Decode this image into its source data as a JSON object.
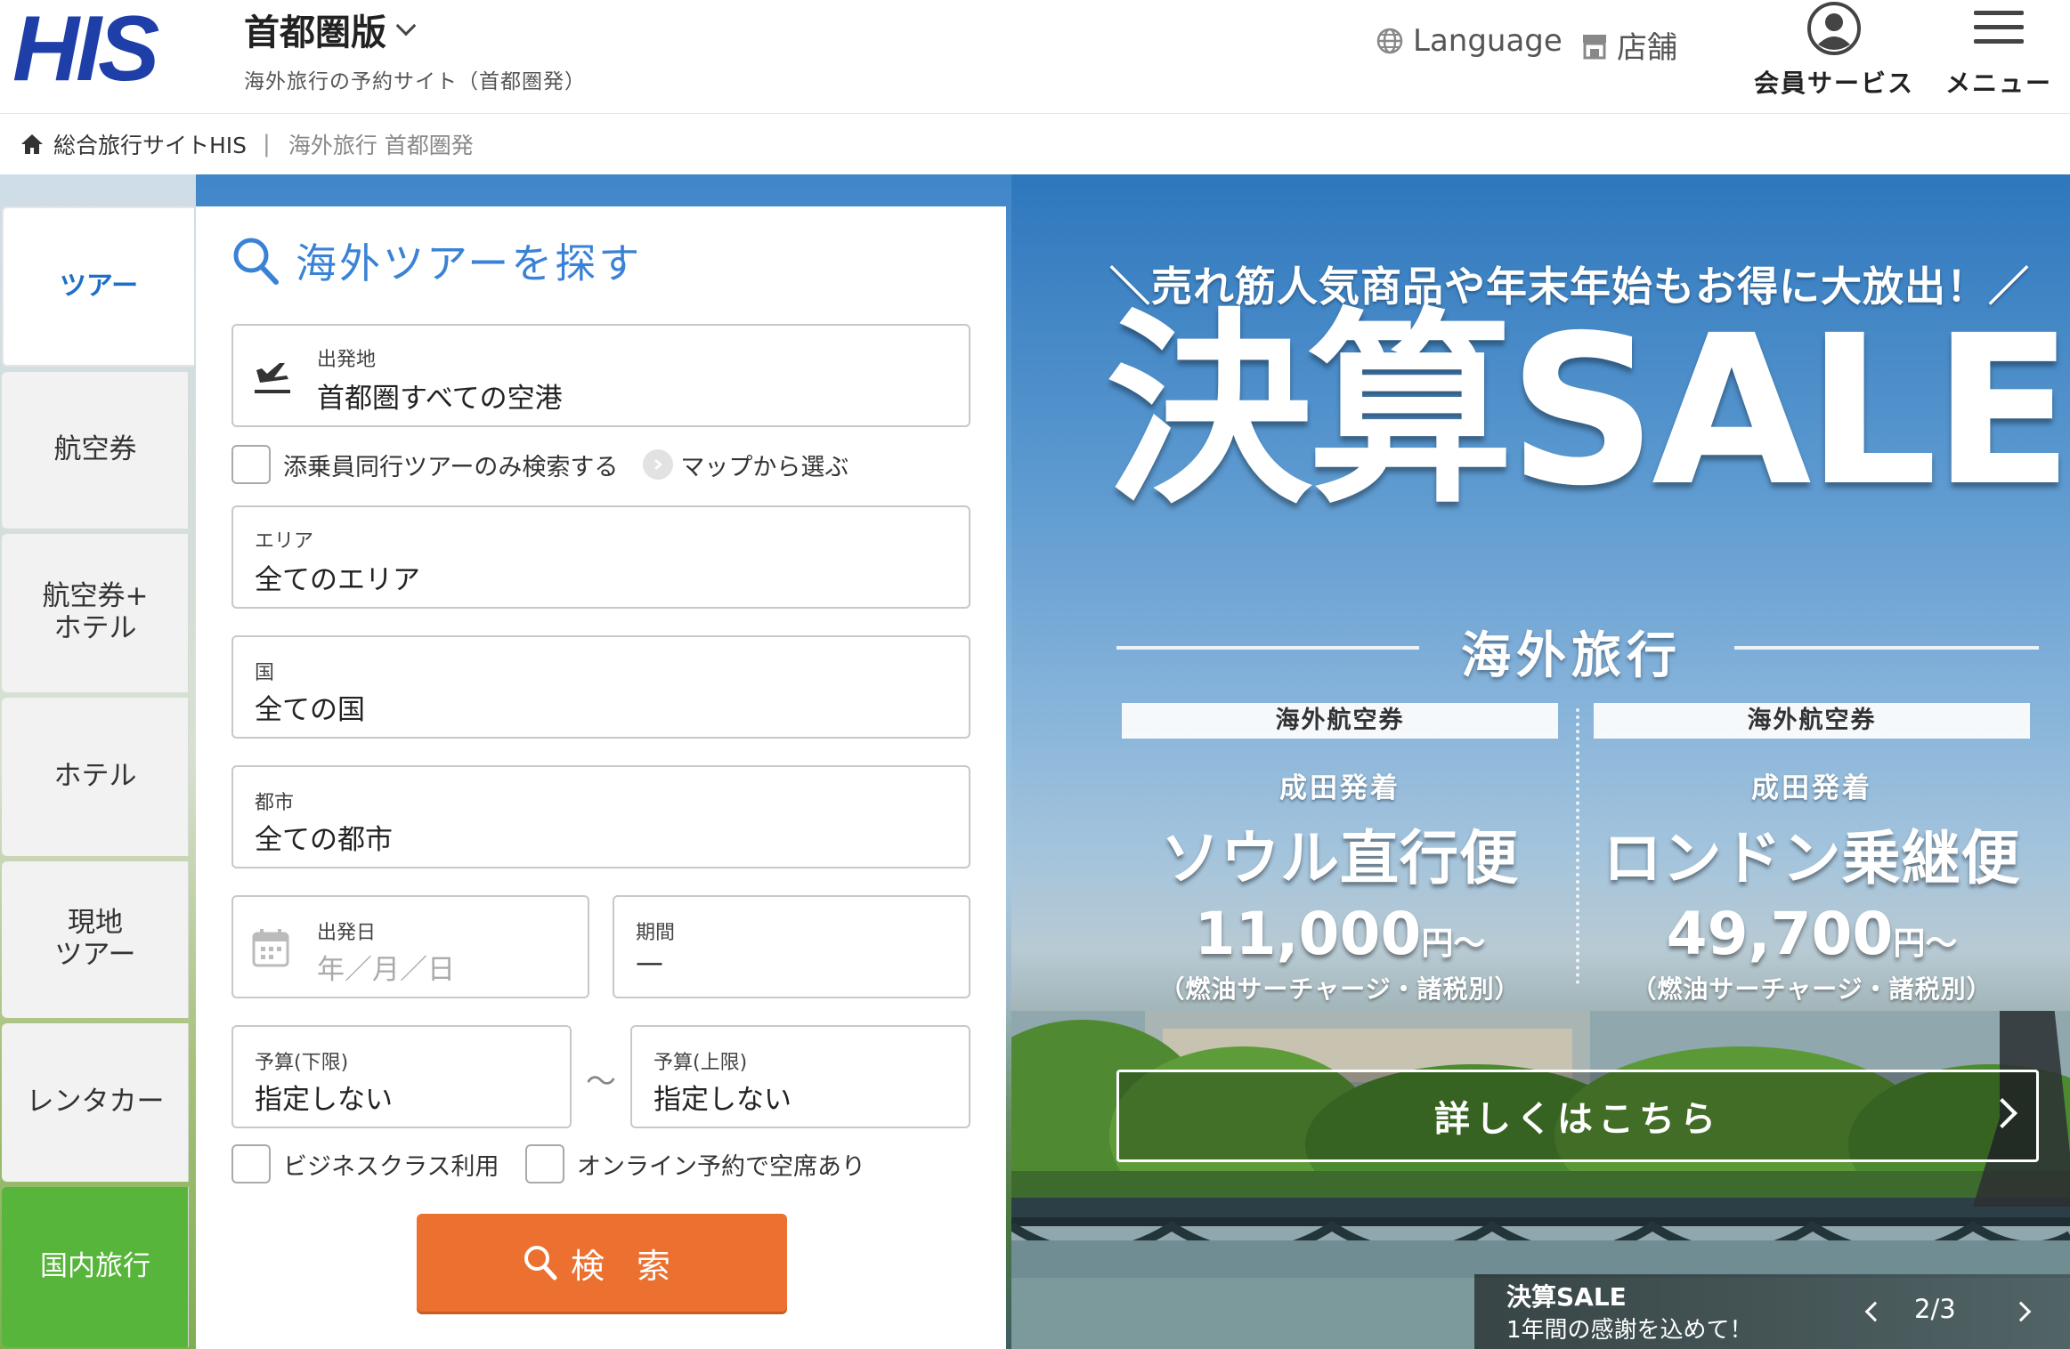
{
  "header": {
    "logo_text": "HIS",
    "site_title": "首都圏版",
    "site_subtitle": "海外旅行の予約サイト（首都圏発）",
    "language_label": "Language",
    "store_label": "店舗",
    "member_label": "会員サービス",
    "menu_label": "メニュー"
  },
  "breadcrumb": {
    "home_label": "総合旅行サイトHIS",
    "current_label": "海外旅行 首都圏発"
  },
  "tabs": {
    "tour": "ツアー",
    "air": "航空券",
    "air_hotel": "航空券+\nホテル",
    "hotel": "ホテル",
    "local_tour": "現地\nツアー",
    "rental_car": "レンタカー",
    "domestic": "国内旅行"
  },
  "form": {
    "title": "海外ツアーを探す",
    "departure_label": "出発地",
    "departure_value": "首都圏すべての空港",
    "escort_only_label": "添乗員同行ツアーのみ検索する",
    "map_link_label": "マップから選ぶ",
    "area_label": "エリア",
    "area_value": "全てのエリア",
    "country_label": "国",
    "country_value": "全ての国",
    "city_label": "都市",
    "city_value": "全ての都市",
    "date_label": "出発日",
    "date_placeholder": "年／月／日",
    "period_label": "期間",
    "period_value": "—",
    "budget_min_label": "予算(下限)",
    "budget_min_value": "指定しない",
    "budget_tilde": "〜",
    "budget_max_label": "予算(上限)",
    "budget_max_value": "指定しない",
    "business_class_label": "ビジネスクラス利用",
    "online_available_label": "オンライン予約で空席あり",
    "search_button_label": "検 索"
  },
  "banner": {
    "tagline": "＼売れ筋人気商品や年末年始もお得に大放出！／",
    "headline": "決算SALE",
    "section_label": "海外旅行",
    "cards": [
      {
        "category": "海外航空券",
        "origin": "成田発着",
        "route": "ソウル直行便",
        "price": "11,000",
        "price_suffix": "円〜",
        "note": "（燃油サーチャージ・諸税別）"
      },
      {
        "category": "海外航空券",
        "origin": "成田発着",
        "route": "ロンドン乗継便",
        "price": "49,700",
        "price_suffix": "円〜",
        "note": "（燃油サーチャージ・諸税別）"
      }
    ],
    "detail_button_label": "詳しくはこちら",
    "caption_title": "決算SALE",
    "caption_subtitle": "1年間の感謝を込めて！",
    "slide_counter": "2/3"
  },
  "colors": {
    "brand_blue": "#1f3fa8",
    "accent_blue": "#3a82d6",
    "search_orange": "#ec7130",
    "domestic_green": "#56b53a"
  }
}
